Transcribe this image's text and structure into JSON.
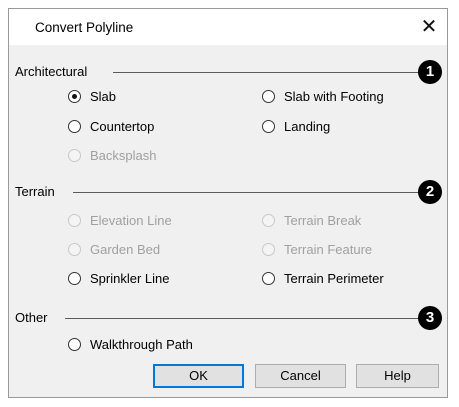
{
  "dialog": {
    "title": "Convert Polyline",
    "close_glyph": "✕"
  },
  "groups": {
    "architectural": {
      "label": "Architectural",
      "callout": "1",
      "options": {
        "slab": {
          "label": "Slab",
          "selected": true,
          "enabled": true
        },
        "slab_with_footing": {
          "label": "Slab with Footing",
          "selected": false,
          "enabled": true
        },
        "countertop": {
          "label": "Countertop",
          "selected": false,
          "enabled": true
        },
        "landing": {
          "label": "Landing",
          "selected": false,
          "enabled": true
        },
        "backsplash": {
          "label": "Backsplash",
          "selected": false,
          "enabled": false
        }
      }
    },
    "terrain": {
      "label": "Terrain",
      "callout": "2",
      "options": {
        "elevation_line": {
          "label": "Elevation Line",
          "selected": false,
          "enabled": false
        },
        "terrain_break": {
          "label": "Terrain Break",
          "selected": false,
          "enabled": false
        },
        "garden_bed": {
          "label": "Garden Bed",
          "selected": false,
          "enabled": false
        },
        "terrain_feature": {
          "label": "Terrain Feature",
          "selected": false,
          "enabled": false
        },
        "sprinkler_line": {
          "label": "Sprinkler Line",
          "selected": false,
          "enabled": true
        },
        "terrain_perimeter": {
          "label": "Terrain Perimeter",
          "selected": false,
          "enabled": true
        }
      }
    },
    "other": {
      "label": "Other",
      "callout": "3",
      "options": {
        "walkthrough_path": {
          "label": "Walkthrough Path",
          "selected": false,
          "enabled": true
        }
      }
    }
  },
  "buttons": {
    "ok": "OK",
    "cancel": "Cancel",
    "help": "Help"
  },
  "colors": {
    "dialog_bg": "#f0f0f0",
    "titlebar_bg": "#ffffff",
    "default_button_border": "#0078d7",
    "disabled_text": "#a0a0a0"
  }
}
